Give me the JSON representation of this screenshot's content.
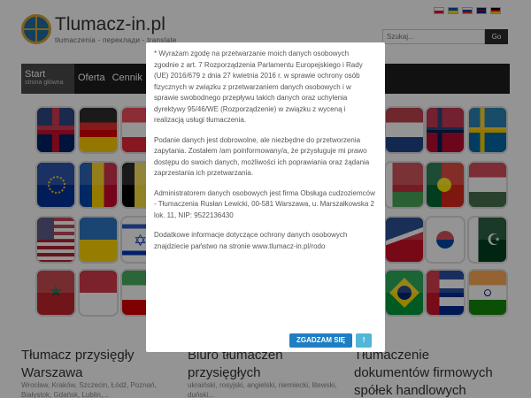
{
  "brand": {
    "title": "Tlumacz-in.pl",
    "tagline": "tłumaczenia - переклади - translate"
  },
  "languages": [
    {
      "name": "pl-flag-icon",
      "colors": [
        "#ffffff",
        "#dc143c"
      ]
    },
    {
      "name": "ua-flag-icon",
      "colors": [
        "#0057b7",
        "#ffd700"
      ]
    },
    {
      "name": "ru-flag-icon",
      "colors": [
        "#ffffff",
        "#0039a6",
        "#d52b1e"
      ]
    },
    {
      "name": "gb-flag-icon",
      "colors": [
        "#012169",
        "#c8102e",
        "#ffffff"
      ]
    },
    {
      "name": "de-flag-icon",
      "colors": [
        "#000000",
        "#dd0000",
        "#ffce00"
      ]
    }
  ],
  "search": {
    "placeholder": "Szukaj...",
    "button_label": "Go"
  },
  "nav": {
    "items": [
      {
        "label": "Start",
        "sub": "strona główna"
      },
      {
        "label": "Oferta",
        "sub": ""
      },
      {
        "label": "Cennik",
        "sub": ""
      }
    ]
  },
  "flags_grid": [
    "gb-flag-icon",
    "de-flag-icon",
    "at-flag-icon",
    "nl-flag-icon",
    "no-flag-icon",
    "se-flag-icon",
    "eu-flag-icon",
    "md-flag-icon",
    "be-flag-icon",
    "by-flag-icon",
    "pt-flag-icon",
    "hu-flag-icon",
    "us-flag-icon",
    "ua-flag-icon",
    "il-flag-icon",
    "as-flag-icon",
    "kr-flag-icon",
    "pk-flag-icon",
    "ma-flag-icon",
    "id-flag-icon",
    "ir-flag-icon",
    "br-flag-icon",
    "cu-flag-icon",
    "in-flag-icon"
  ],
  "cards": [
    {
      "title": "Tłumacz przysięgły Warszawa",
      "sub": "Wrocław, Kraków, Szczecin, Łódź, Poznań, Białystok, Gdańsk, Lublin,..."
    },
    {
      "title": "Biuro tłumaczeń przysięgłych",
      "sub": "ukraiński, rosyjski, angielski, niemiecki, litewski, duński..."
    },
    {
      "title": "Tłumaczenie dokumentów firmowych spółek handlowych",
      "sub": ""
    }
  ],
  "modal": {
    "paragraphs": [
      "* Wyrażam zgodę na przetwarzanie moich danych osobowych zgodnie z art. 7 Rozporządzenia Parlamentu Europejskiego i Rady (UE) 2016/679 z dnia 27 kwietnia 2016 r. w sprawie ochrony osób fizycznych w związku z przetwarzaniem danych osobowych i w sprawie swobodnego przepływu takich danych oraz uchylenia dyrektywy 95/46/WE (Rozporządzenie) w związku z wyceną i realizacją usługi tłumaczenia.",
      "Podanie danych jest dobrowolne, ale niezbędne do przetworzenia zapytania. Zostałem /am poinformowany/a, że przysługuje mi prawo dostępu do swoich danych, możliwości ich poprawiania oraz żądania zaprzestania ich przetwarzania.",
      "Administratorem danych osobowych jest firma Obsługa cudzoziemców - Tłumaczenia Rusłan Lewicki, 00-581 Warszawa, u. Marszałkowska 2 lok. 11, NIP: 9522136430",
      "Dodatkowe informacje dotyczące ochrony danych osobowych znajdziecie państwo na stronie www.tlumacz-in.pl/rodo"
    ],
    "accept_label": "ZGADZAM SIĘ",
    "info_label": "!"
  },
  "colors": {
    "accent": "#1f7ec2",
    "info": "#52b6d8",
    "nav_bg": "#1e1e1e"
  }
}
